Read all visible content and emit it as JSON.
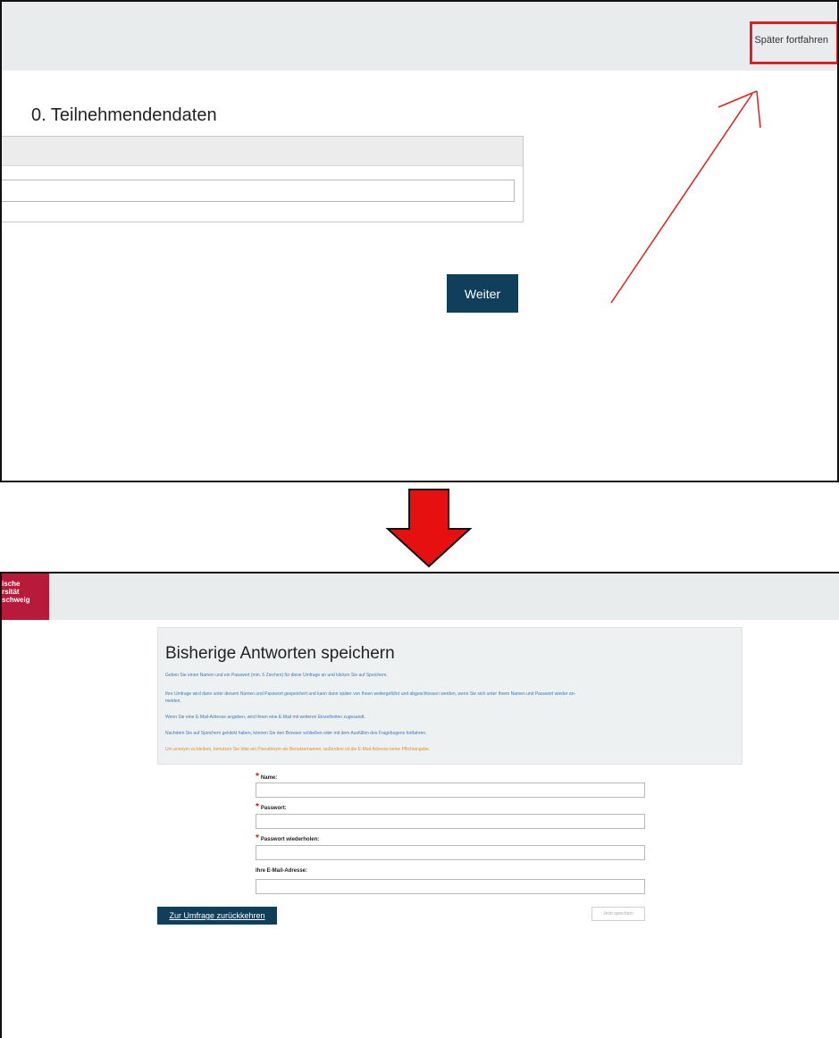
{
  "top_screen": {
    "later_button_label": "Später fortfahren",
    "section_title": "0. Teilnehmendendaten",
    "next_button_label": "Weiter",
    "highlight_color": "#e02020"
  },
  "bottom_screen": {
    "logo_text": "ische\nrsität\nschweig",
    "title": "Bisherige Antworten speichern",
    "info_lines": [
      "Geben Sie einen Namen und ein Passwort (min. 5 Zeichen) für diese Umfrage an und klicken Sie auf Speichern.",
      "Ihre Umfrage wird dann unter diesem Namen und Passwort gespeichert und kann dann später von Ihnen weitergeführt und abgeschlossen werden, wenn Sie sich unter Ihrem Namen und Passwort wieder an-",
      "melden.",
      "Wenn Sie eine E-Mail-Adresse angeben, wird Ihnen eine E-Mail mit weiteren Einzelheiten zugesandt.",
      "Nachdem Sie auf Speichern geklickt haben, können Sie den Browser schließen oder mit dem Ausfüllen des Fragebogens fortfahren.",
      "Um anonym zu bleiben, benutzen Sie bitte ein Pseudonym als Benutzernamen, außerdem ist die E-Mail-Adresse keine Pflichtangabe."
    ],
    "fields": {
      "name_label": "Name:",
      "password_label": "Passwort:",
      "password_repeat_label": "Passwort wiederholen:",
      "email_label": "Ihre E-Mail-Adresse:"
    },
    "back_button_label": "Zur Umfrage zurückkehren",
    "save_button_label": "Jetzt speichern"
  }
}
